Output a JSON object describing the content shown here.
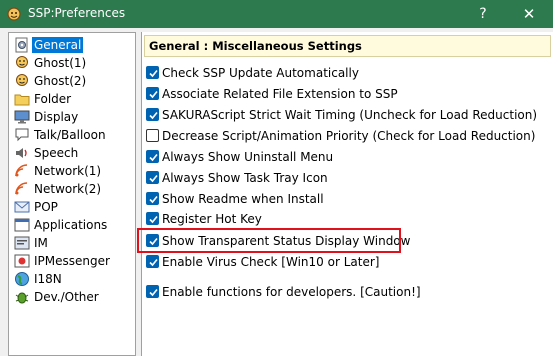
{
  "window": {
    "title": "SSP:Preferences",
    "help_glyph": "?",
    "close_glyph": "✕"
  },
  "sidebar": {
    "items": [
      {
        "label": "General",
        "icon": "gear-doc-icon",
        "selected": true
      },
      {
        "label": "Ghost(1)",
        "icon": "ghost-icon"
      },
      {
        "label": "Ghost(2)",
        "icon": "ghost-icon"
      },
      {
        "label": "Folder",
        "icon": "folder-icon"
      },
      {
        "label": "Display",
        "icon": "display-icon"
      },
      {
        "label": "Talk/Balloon",
        "icon": "balloon-icon"
      },
      {
        "label": "Speech",
        "icon": "speaker-icon"
      },
      {
        "label": "Network(1)",
        "icon": "network-icon"
      },
      {
        "label": "Network(2)",
        "icon": "network-icon"
      },
      {
        "label": "POP",
        "icon": "mail-icon"
      },
      {
        "label": "Applications",
        "icon": "applications-icon"
      },
      {
        "label": "IM",
        "icon": "im-icon"
      },
      {
        "label": "IPMessenger",
        "icon": "ipmessenger-icon"
      },
      {
        "label": "I18N",
        "icon": "globe-icon"
      },
      {
        "label": "Dev./Other",
        "icon": "bug-icon"
      }
    ]
  },
  "main": {
    "header": "General : Miscellaneous Settings",
    "options": [
      {
        "label": "Check SSP Update Automatically",
        "checked": true
      },
      {
        "label": "Associate Related File Extension to SSP",
        "checked": true
      },
      {
        "label": "SAKURAScript Strict Wait Timing (Uncheck for Load Reduction)",
        "checked": true
      },
      {
        "label": "Decrease Script/Animation Priority (Check for Load Reduction)",
        "checked": false
      },
      {
        "label": "Always Show Uninstall Menu",
        "checked": true
      },
      {
        "label": "Always Show Task Tray Icon",
        "checked": true
      },
      {
        "label": "Show Readme when Install",
        "checked": true
      },
      {
        "label": "Register Hot Key",
        "checked": true
      },
      {
        "label": "Show Transparent Status Display Window",
        "checked": true
      },
      {
        "label": "Enable Virus Check [Win10 or Later]",
        "checked": true
      },
      {
        "label": "Enable functions for developers. [Caution!]",
        "checked": true
      }
    ]
  }
}
